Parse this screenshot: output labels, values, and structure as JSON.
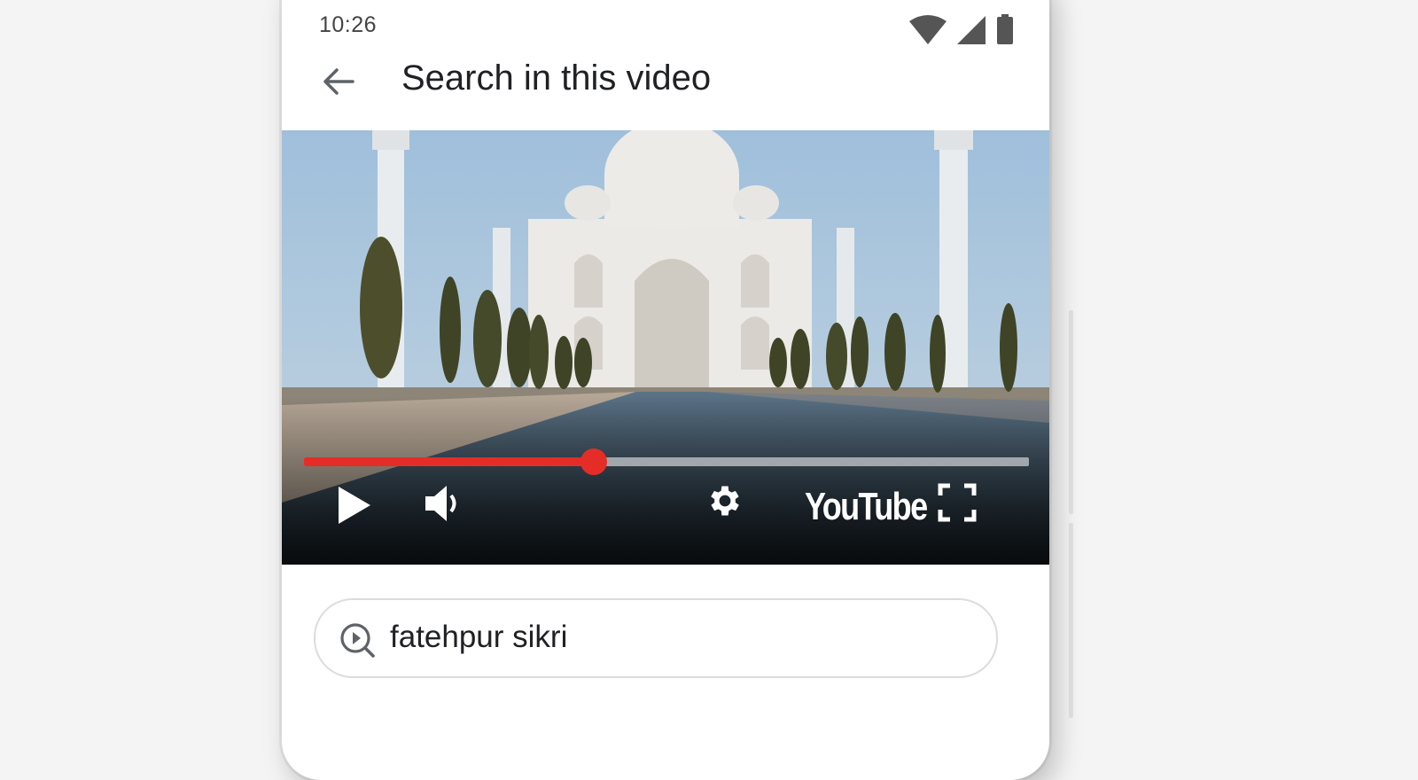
{
  "status_bar": {
    "time": "10:26",
    "icons": [
      "wifi-icon",
      "cellular-signal-icon",
      "battery-icon"
    ]
  },
  "app_bar": {
    "back_icon": "arrow-back-icon",
    "title": "Search in this video"
  },
  "video_player": {
    "scene": "taj-mahal-video-frame",
    "progress_fraction": 0.4,
    "controls": {
      "play_icon": "play-icon",
      "volume_icon": "volume-icon",
      "settings_icon": "gear-icon",
      "brand_label": "YouTube",
      "fullscreen_icon": "fullscreen-icon"
    },
    "colors": {
      "progress": "#e52d27",
      "track": "#ffffff"
    }
  },
  "search": {
    "icon": "video-search-icon",
    "value": "fatehpur sikri"
  }
}
